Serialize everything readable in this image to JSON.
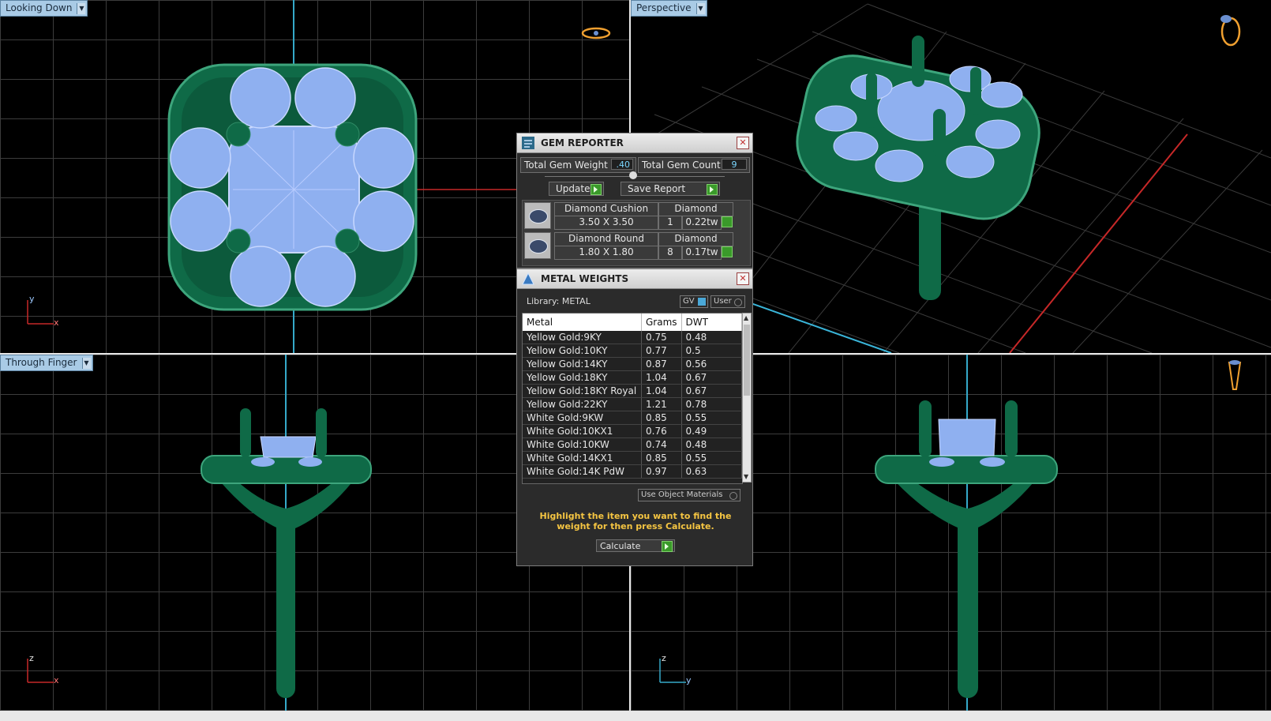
{
  "viewports": {
    "top_left": {
      "label": "Looking Down",
      "axis_v": "y",
      "axis_h": "x"
    },
    "top_right": {
      "label": "Perspective"
    },
    "bottom_left": {
      "label": "Through Finger",
      "axis_v": "z",
      "axis_h": "x"
    },
    "bottom_right": {
      "label": "",
      "axis_v": "z",
      "axis_h": "y"
    }
  },
  "gem_reporter": {
    "title": "GEM REPORTER",
    "total_weight_label": "Total Gem Weight",
    "total_weight_value": ".40",
    "total_count_label": "Total Gem Count",
    "total_count_value": "9",
    "update_label": "Update",
    "save_label": "Save Report",
    "gems": [
      {
        "name": "Diamond Cushion",
        "size": "3.50 X 3.50",
        "material": "Diamond",
        "count": "1",
        "weight": "0.22tw"
      },
      {
        "name": "Diamond Round",
        "size": "1.80 X 1.80",
        "material": "Diamond",
        "count": "8",
        "weight": "0.17tw"
      }
    ]
  },
  "metal_weights": {
    "title": "METAL WEIGHTS",
    "library_label": "Library: METAL",
    "gv_label": "GV",
    "user_label": "User",
    "columns": [
      "Metal",
      "Grams",
      "DWT"
    ],
    "rows": [
      {
        "metal": "Yellow Gold:9KY",
        "grams": "0.75",
        "dwt": "0.48"
      },
      {
        "metal": "Yellow Gold:10KY",
        "grams": "0.77",
        "dwt": "0.5"
      },
      {
        "metal": "Yellow Gold:14KY",
        "grams": "0.87",
        "dwt": "0.56"
      },
      {
        "metal": "Yellow Gold:18KY",
        "grams": "1.04",
        "dwt": "0.67"
      },
      {
        "metal": "Yellow Gold:18KY Royal",
        "grams": "1.04",
        "dwt": "0.67"
      },
      {
        "metal": "Yellow Gold:22KY",
        "grams": "1.21",
        "dwt": "0.78"
      },
      {
        "metal": "White Gold:9KW",
        "grams": "0.85",
        "dwt": "0.55"
      },
      {
        "metal": "White Gold:10KX1",
        "grams": "0.76",
        "dwt": "0.49"
      },
      {
        "metal": "White Gold:10KW",
        "grams": "0.74",
        "dwt": "0.48"
      },
      {
        "metal": "White Gold:14KX1",
        "grams": "0.85",
        "dwt": "0.55"
      },
      {
        "metal": "White Gold:14K PdW",
        "grams": "0.97",
        "dwt": "0.63"
      }
    ],
    "use_object_label": "Use Object Materials",
    "hint": "Highlight the item you want to find the weight for then press Calculate.",
    "calculate_label": "Calculate"
  },
  "colors": {
    "metal_green": "#0d6b47",
    "gem_blue": "#8fb0f0",
    "label_bg": "#a9cbe6",
    "hint_yellow": "#f5c542",
    "axis_red": "#c62828",
    "axis_cyan": "#35a9c9"
  }
}
